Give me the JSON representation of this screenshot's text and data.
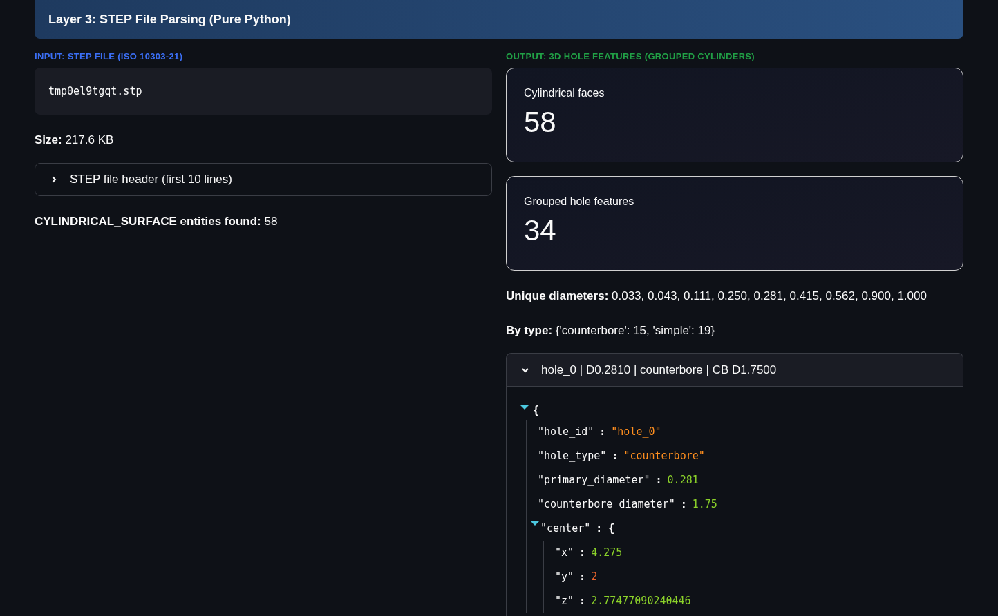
{
  "header": {
    "title": "Layer 3: STEP File Parsing (Pure Python)"
  },
  "input": {
    "label": "INPUT: STEP FILE (ISO 10303-21)",
    "filename": "tmp0el9tgqt.stp",
    "size": {
      "label": "Size:",
      "value": "217.6 KB"
    },
    "expander": {
      "title": "STEP file header (first 10 lines)",
      "expanded": false
    },
    "entities": {
      "label": "CYLINDRICAL_SURFACE entities found:",
      "value": "58"
    }
  },
  "output": {
    "label": "OUTPUT: 3D HOLE FEATURES (GROUPED CYLINDERS)",
    "metrics": [
      {
        "label": "Cylindrical faces",
        "value": "58"
      },
      {
        "label": "Grouped hole features",
        "value": "34"
      }
    ],
    "diameters": {
      "label": "Unique diameters:",
      "value": "0.033, 0.043, 0.111, 0.250, 0.281, 0.415, 0.562, 0.900, 1.000"
    },
    "by_type": {
      "label": "By type:",
      "value": "{'counterbore': 15, 'simple': 19}"
    },
    "hole_expander": {
      "title": "hole_0 | D0.2810 | counterbore | CB D1.7500",
      "expanded": true,
      "json": {
        "kind": "object",
        "separator": ":",
        "open": "{",
        "expanded": true,
        "children": [
          {
            "key": "\"hole_id\"",
            "kind": "string",
            "value": "\"hole_0\""
          },
          {
            "key": "\"hole_type\"",
            "kind": "string",
            "value": "\"counterbore\""
          },
          {
            "key": "\"primary_diameter\"",
            "kind": "float",
            "value": "0.281"
          },
          {
            "key": "\"counterbore_diameter\"",
            "kind": "float",
            "value": "1.75"
          },
          {
            "key": "\"center\"",
            "kind": "object",
            "open": "{",
            "expanded": true,
            "children": [
              {
                "key": "\"x\"",
                "kind": "float",
                "value": "4.275"
              },
              {
                "key": "\"y\"",
                "kind": "int",
                "value": "2"
              },
              {
                "key": "\"z\"",
                "kind": "float",
                "value": "2.77477090240446"
              }
            ]
          }
        ]
      }
    }
  }
}
